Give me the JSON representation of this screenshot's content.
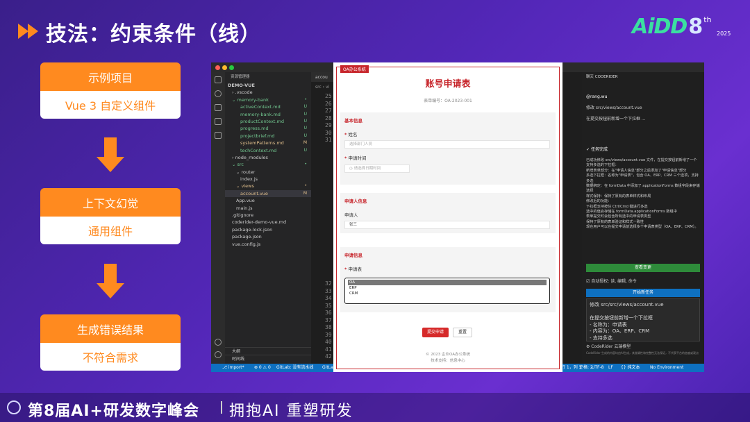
{
  "header": {
    "title": "技法：约束条件（线）",
    "brand": "AiDD",
    "brand_edition": "8",
    "brand_suffix": "th",
    "brand_year": "2025"
  },
  "flow": [
    {
      "top": "示例项目",
      "bottom": "Vue 3 自定义组件"
    },
    {
      "top": "上下文幻觉",
      "bottom": "通用组件"
    },
    {
      "top": "生成错误结果",
      "bottom": "不符合需求"
    }
  ],
  "ide": {
    "explorer_title": "资源管理器",
    "project": "DEMO-VUE",
    "files": [
      {
        "indent": 1,
        "label": "› .vscode",
        "status": ""
      },
      {
        "indent": 1,
        "label": "⌄ memory-bank",
        "status": "•",
        "color": "#73c991"
      },
      {
        "indent": 3,
        "label": "activeContext.md",
        "status": "U",
        "color": "#73c991"
      },
      {
        "indent": 3,
        "label": "memory-bank.md",
        "status": "U",
        "color": "#73c991"
      },
      {
        "indent": 3,
        "label": "productContext.md",
        "status": "U",
        "color": "#73c991"
      },
      {
        "indent": 3,
        "label": "progress.md",
        "status": "U",
        "color": "#73c991"
      },
      {
        "indent": 3,
        "label": "projectbrief.md",
        "status": "U",
        "color": "#73c991"
      },
      {
        "indent": 3,
        "label": "systemPatterns.md",
        "status": "M",
        "color": "#e2c08d"
      },
      {
        "indent": 3,
        "label": "techContext.md",
        "status": "U",
        "color": "#73c991"
      },
      {
        "indent": 1,
        "label": "› node_modules",
        "status": ""
      },
      {
        "indent": 1,
        "label": "⌄ src",
        "status": "•",
        "color": "#73c991"
      },
      {
        "indent": 2,
        "label": "⌄ router",
        "status": ""
      },
      {
        "indent": 3,
        "label": "index.js",
        "status": ""
      },
      {
        "indent": 2,
        "label": "⌄ views",
        "status": "•",
        "color": "#e2c08d"
      },
      {
        "indent": 3,
        "label": "account.vue",
        "status": "M",
        "color": "#e2c08d",
        "selected": true
      },
      {
        "indent": 2,
        "label": "App.vue",
        "status": ""
      },
      {
        "indent": 2,
        "label": "main.js",
        "status": ""
      },
      {
        "indent": 1,
        "label": ".gitignore",
        "status": ""
      },
      {
        "indent": 1,
        "label": "coderider-demo-vue.md",
        "status": ""
      },
      {
        "indent": 1,
        "label": "package-lock.json",
        "status": ""
      },
      {
        "indent": 1,
        "label": "package.json",
        "status": ""
      },
      {
        "indent": 1,
        "label": "vue.config.js",
        "status": ""
      }
    ],
    "footer_items": [
      "大纲",
      "时间线"
    ],
    "editor_tab": "accou",
    "breadcrumb": "src › vi",
    "line_numbers_top": [
      "25",
      "26",
      "27",
      "28",
      "29",
      "30",
      "31"
    ],
    "line_numbers_bottom": [
      "32",
      "33",
      "34",
      "35",
      "36",
      "37",
      "38",
      "39",
      "40",
      "41",
      "42"
    ],
    "status_left": "⎇ import*",
    "status_errors": "⊗ 0 ⚠ 0",
    "status_gitlab": "GitLab: 没有流水线",
    "status_gitlab2": "GitLa",
    "status_right": [
      "行 1，列 1",
      "空格: 2",
      "UTF-8",
      "LF",
      "{} 纯文本",
      "No Environment"
    ]
  },
  "assistant": {
    "panel_title": "聊天 CODERIDER",
    "user": "@rang.wu",
    "request": "修改 src/views/account.vue",
    "request2": "在提交按钮前新增一个下拉框 ...",
    "done": "任务完成",
    "result": [
      "已成功修改 src/views/account.vue 文件，在提交按钮前新增了一个支持多选的下拉框：",
      "新增表单部分：在\"申请人信息\"部分之后添加了\"申请信息\"部分",
      "多选下拉框：名称为\"申请表\"，包含 OA、ERP、CRM 三个选项，支持多选",
      "数据绑定：在 formData 中添加了 applicationForms 数组字段来存储选择",
      "样式保持：保持了原有的表单样式和布局",
      "修改后的功能：",
      "下拉框支持按住 Ctrl/Cmd 键进行多选",
      "选中的值会存储在 formData.applicationForms 数组中",
      "表单提交时会包含所有选中的申请表类型",
      "保持了原有的表单验证和样式一致性",
      "现在用户可以在提交申请前选择多个申请表类型（OA、ERP、CRM）。"
    ],
    "view_changes": "查看变更",
    "auto_approve": "自动授权: 读, 编辑, 命令",
    "new_task": "开始新任务",
    "input_lines": [
      "修改 src/src/views/account.vue",
      "",
      "在提交按钮前新增一个下拉框",
      "- 名称为：申请表",
      "- 内容为：OA、ERP、CRM",
      "- 支持多选"
    ],
    "model": "CodeRider 云端模型",
    "disclaimer": "CodeRider 生成的内容均由AI生成，其准确性和完整性无法保证，不代表平台的态度或观点"
  },
  "form": {
    "badge": "OA办公系统",
    "title": "账号申请表",
    "number": "表单编号：OA-2023-001",
    "sec_basic": "基本信息",
    "name_label": "姓名",
    "name_placeholder": "选择部门人员",
    "time_label": "申请时间",
    "time_placeholder": "请选择日期时间",
    "sec_applicant": "申请人信息",
    "applicant_label": "申请人",
    "applicant_value": "张三",
    "sec_apply": "申请信息",
    "app_label": "申请表",
    "options": [
      "OA",
      "ERP",
      "CRM"
    ],
    "submit": "提交申请",
    "reset": "重置",
    "copyright": "© 2023 企业OA办公系统",
    "support": "技术支持：信息中心"
  },
  "footer": {
    "title": "第8届AI+研发数字峰会",
    "slogan": "拥抱AI 重塑研发"
  }
}
